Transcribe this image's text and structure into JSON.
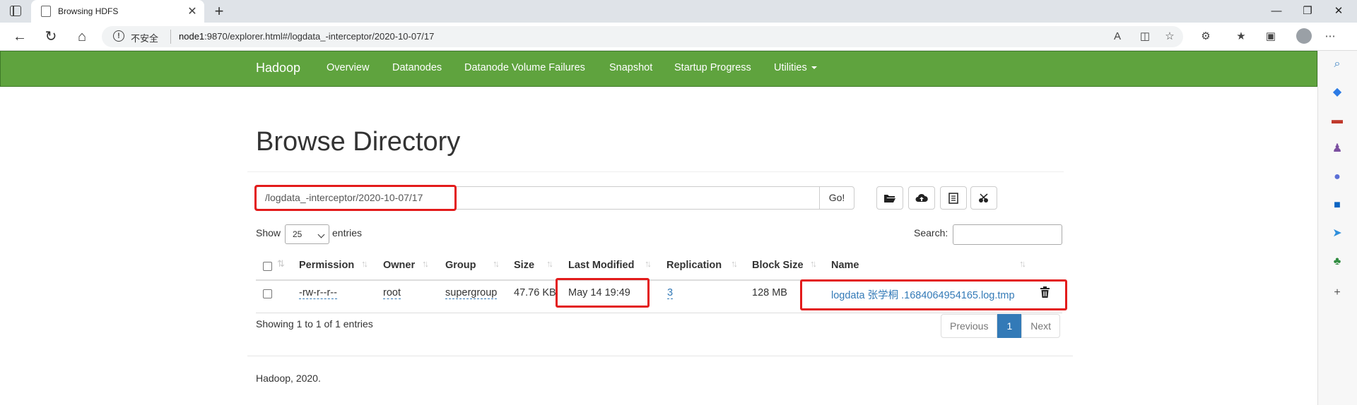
{
  "browser": {
    "tab_title": "Browsing HDFS",
    "not_secure": "不安全",
    "url_host": "node1",
    "url_rest": ":9870/explorer.html#/logdata_-interceptor/2020-10-07/17"
  },
  "navbar": {
    "brand": "Hadoop",
    "links": [
      "Overview",
      "Datanodes",
      "Datanode Volume Failures",
      "Snapshot",
      "Startup Progress",
      "Utilities"
    ],
    "bg_color": "#5fa33e"
  },
  "page": {
    "title": "Browse Directory",
    "path_value": "/logdata_-interceptor/2020-10-07/17",
    "go_label": "Go!",
    "tool_icons": [
      "folder-open-icon",
      "upload-icon",
      "list-icon",
      "cut-icon"
    ],
    "show_label": "Show",
    "page_size": "25",
    "entries_label": "entries",
    "search_label": "Search:"
  },
  "table": {
    "headers": [
      "Permission",
      "Owner",
      "Group",
      "Size",
      "Last Modified",
      "Replication",
      "Block Size",
      "Name"
    ],
    "rows": [
      {
        "permission": "-rw-r--r--",
        "owner": "root",
        "group": "supergroup",
        "size": "47.76 KB",
        "modified": "May 14 19:49",
        "replication": "3",
        "block_size": "128 MB",
        "name": "logdata 张学桐 .1684064954165.log.tmp"
      }
    ],
    "highlight_color": "#e31b1b"
  },
  "pagination": {
    "showing": "Showing 1 to 1 of 1 entries",
    "previous": "Previous",
    "current": "1",
    "next": "Next"
  },
  "footer": "Hadoop, 2020."
}
